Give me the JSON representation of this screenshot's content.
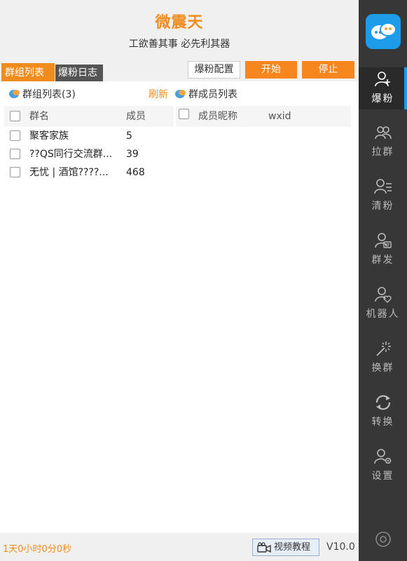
{
  "app": {
    "title": "微震天",
    "slogan": "工欲善其事 必先利其器"
  },
  "tabs": [
    {
      "label": "群组列表",
      "active": true
    },
    {
      "label": "爆粉日志",
      "active": false
    }
  ],
  "toolbar": {
    "config_label": "爆粉配置",
    "start_label": "开始",
    "stop_label": "停止"
  },
  "group_section": {
    "title": "群组列表(3)",
    "refresh_label": "刷新",
    "columns": [
      "群名",
      "成员"
    ],
    "rows": [
      {
        "name": "聚客家族",
        "members": "5"
      },
      {
        "name": "??QS同行交流群...",
        "members": "39"
      },
      {
        "name": "无忧 | 酒馆????...",
        "members": "468"
      }
    ]
  },
  "member_section": {
    "title": "群成员列表",
    "columns": [
      "成员昵称",
      "wxid"
    ]
  },
  "footer": {
    "timer": "1天0小时0分0秒",
    "video_label": "视频教程",
    "version": "V10.0"
  },
  "sidebar": {
    "items": [
      {
        "label": "爆粉",
        "icon": "user-add-icon",
        "active": true
      },
      {
        "label": "拉群",
        "icon": "group-icon",
        "active": false
      },
      {
        "label": "清粉",
        "icon": "user-list-icon",
        "active": false
      },
      {
        "label": "群发",
        "icon": "user-message-icon",
        "active": false
      },
      {
        "label": "机器人",
        "icon": "user-heart-icon",
        "active": false
      },
      {
        "label": "换群",
        "icon": "magic-wand-icon",
        "active": false
      },
      {
        "label": "转换",
        "icon": "refresh-icon",
        "active": false
      },
      {
        "label": "设置",
        "icon": "user-settings-icon",
        "active": false
      }
    ]
  },
  "colors": {
    "accent": "#f08c1e",
    "sidebar_bg": "#373737",
    "brand_blue": "#1e9be9"
  }
}
